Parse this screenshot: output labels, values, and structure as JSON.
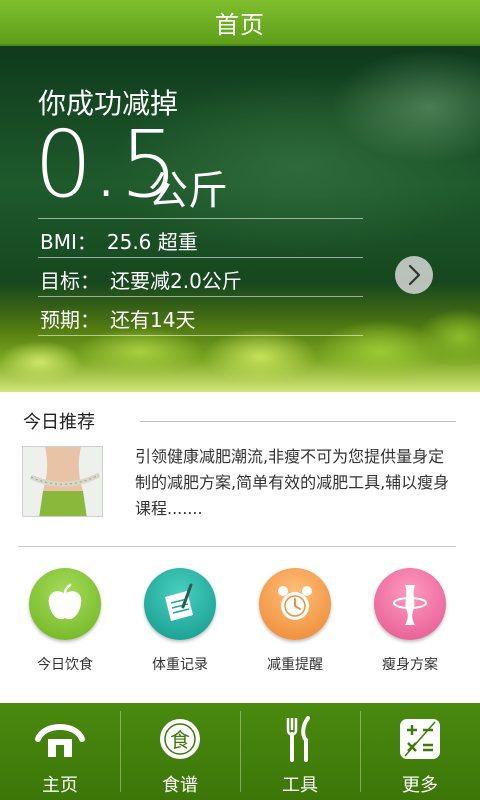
{
  "header": {
    "title": "首页"
  },
  "hero": {
    "caption": "你成功减掉",
    "amount": "0.5",
    "unit": "公斤",
    "stats": [
      {
        "label": "BMI：",
        "value": "25.6  超重"
      },
      {
        "label": "目标：",
        "value": "还要减2.0公斤"
      },
      {
        "label": "预期：",
        "value": "还有14天"
      }
    ]
  },
  "recommendation": {
    "title": "今日推荐",
    "text": "引领健康减肥潮流,非瘦不可为您提供量身定制的减肥方案,简单有效的减肥工具,辅以瘦身课程.......",
    "thumbnail_icon": "waist-measure-photo"
  },
  "features": [
    {
      "label": "今日饮食",
      "icon": "apple-icon",
      "color": "#7cc22a"
    },
    {
      "label": "体重记录",
      "icon": "notepad-pen-icon",
      "color": "#1ba99a"
    },
    {
      "label": "减重提醒",
      "icon": "alarm-clock-icon",
      "color": "#f0903a"
    },
    {
      "label": "瘦身方案",
      "icon": "body-tape-icon",
      "color": "#e8669a"
    }
  ],
  "bottom_nav": [
    {
      "label": "主页",
      "icon": "home-icon"
    },
    {
      "label": "食谱",
      "icon": "recipe-plate-icon",
      "icon_glyph": "食"
    },
    {
      "label": "工具",
      "icon": "fork-knife-icon"
    },
    {
      "label": "更多",
      "icon": "calculator-icon"
    }
  ],
  "colors": {
    "primary": "#5e9e1a",
    "nav": "#3f7a0a"
  }
}
